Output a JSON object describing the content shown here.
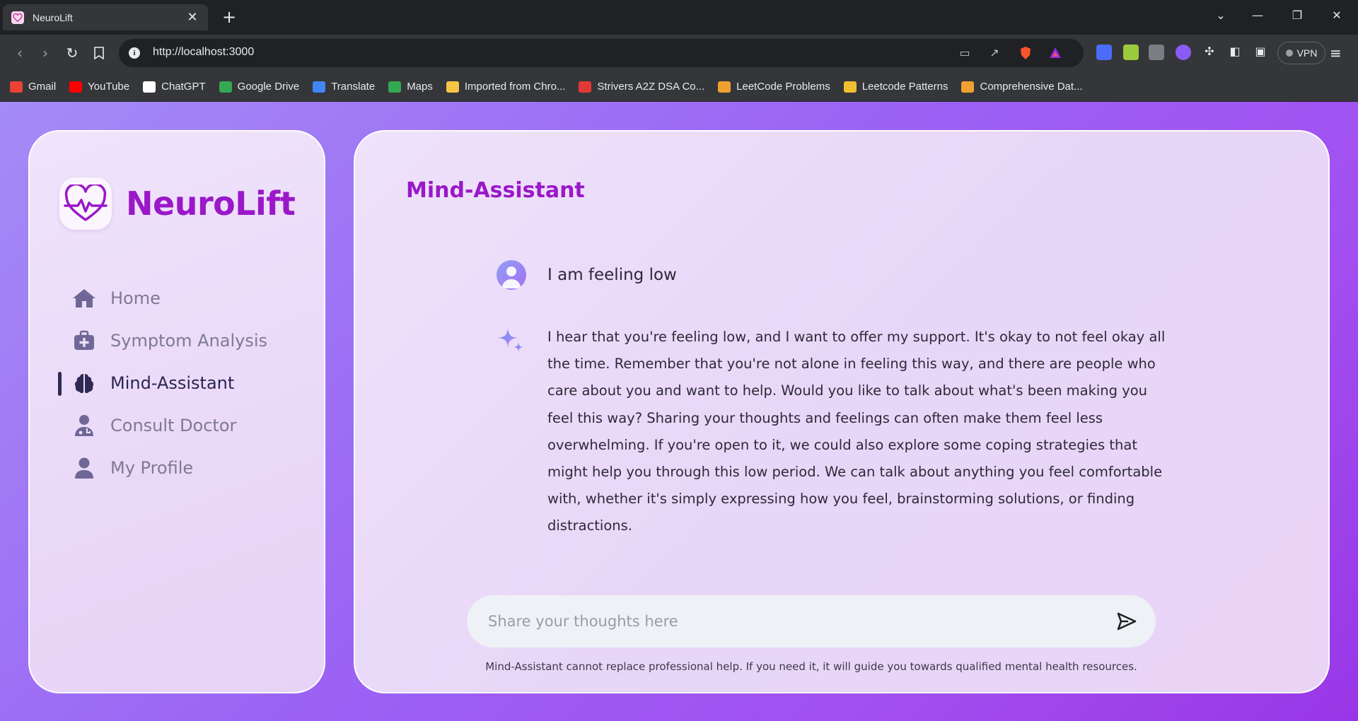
{
  "browser": {
    "tab_title": "NeuroLift",
    "url": "http://localhost:3000",
    "vpn_label": "VPN",
    "bookmarks": [
      {
        "label": "Gmail",
        "color": "#ea4335"
      },
      {
        "label": "YouTube",
        "color": "#ff0000"
      },
      {
        "label": "ChatGPT",
        "color": "#ffffff"
      },
      {
        "label": "Google Drive",
        "color": "#34a853"
      },
      {
        "label": "Translate",
        "color": "#4285f4"
      },
      {
        "label": "Maps",
        "color": "#34a853"
      },
      {
        "label": "Imported from Chro...",
        "color": "#f6c344"
      },
      {
        "label": "Strivers A2Z DSA Co...",
        "color": "#e53935"
      },
      {
        "label": "LeetCode Problems",
        "color": "#f0a030"
      },
      {
        "label": "Leetcode Patterns",
        "color": "#f0c030"
      },
      {
        "label": "Comprehensive Dat...",
        "color": "#f0a030"
      }
    ]
  },
  "app": {
    "brand_name": "NeuroLift",
    "accent_color": "#9a18c8",
    "nav": [
      {
        "label": "Home",
        "icon": "home-icon",
        "active": false
      },
      {
        "label": "Symptom Analysis",
        "icon": "medkit-icon",
        "active": false
      },
      {
        "label": "Mind-Assistant",
        "icon": "brain-icon",
        "active": true
      },
      {
        "label": "Consult Doctor",
        "icon": "doctor-icon",
        "active": false
      },
      {
        "label": "My Profile",
        "icon": "user-icon",
        "active": false
      }
    ],
    "page_title": "Mind-Assistant",
    "messages": {
      "user": "I am feeling low",
      "assistant": "I hear that you're feeling low, and I want to offer my support. It's okay to not feel okay all the time. Remember that you're not alone in feeling this way, and there are people who care about you and want to help. Would you like to talk about what's been making you feel this way? Sharing your thoughts and feelings can often make them feel less overwhelming. If you're open to it, we could also explore some coping strategies that might help you through this low period. We can talk about anything you feel comfortable with, whether it's simply expressing how you feel, brainstorming solutions, or finding distractions."
    },
    "composer": {
      "placeholder": "Share your thoughts here",
      "value": ""
    },
    "disclaimer": "Mind-Assistant cannot replace professional help. If you need it, it will guide you towards qualified mental health resources."
  }
}
